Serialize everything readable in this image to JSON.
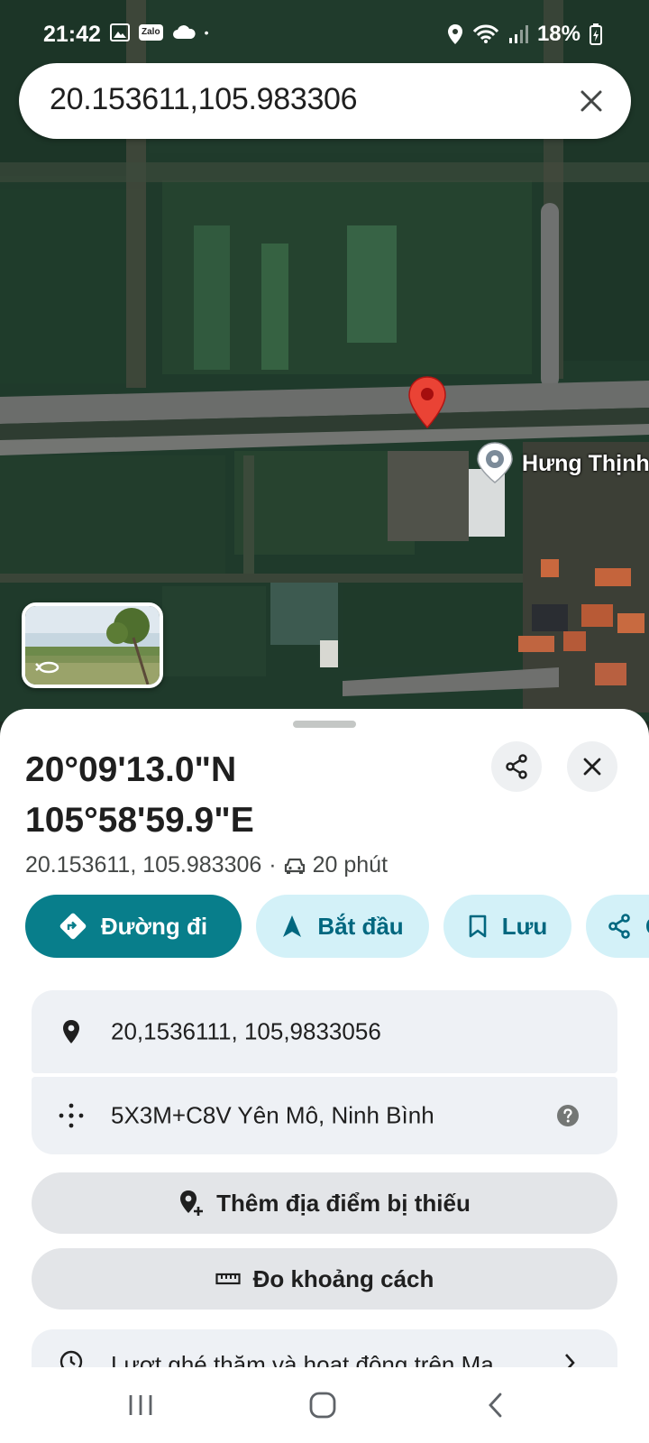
{
  "status_bar": {
    "time": "21:42",
    "zalo_label": "Zalo",
    "dot": "•",
    "battery": "18%"
  },
  "search": {
    "query": "20.153611,105.983306",
    "clear_icon": "close-icon"
  },
  "map": {
    "place_label": "Hưng Thịnh",
    "pin_color": "#ea4335"
  },
  "sheet": {
    "title_lat": "20°09'13.0\"N",
    "title_lng": "105°58'59.9\"E",
    "decimal_coords": "20.153611, 105.983306",
    "separator": "·",
    "drive_time": "20 phút",
    "actions": [
      {
        "label": "Đường đi",
        "icon": "directions-icon"
      },
      {
        "label": "Bắt đầu",
        "icon": "navigation-arrow-icon"
      },
      {
        "label": "Lưu",
        "icon": "bookmark-icon"
      },
      {
        "label": "Ch",
        "icon": "share-icon"
      }
    ],
    "coords_row": "20,1536111, 105,9833056",
    "pluscode_row": "5X3M+C8V Yên Mô, Ninh Bình",
    "add_missing_place": "Thêm địa điểm bị thiếu",
    "measure_distance": "Đo khoảng cách",
    "partial_row": "Lượt ghé thăm và hoạt động trên Ma"
  },
  "colors": {
    "accent": "#087e8b",
    "chip_bg": "#d3f1f8",
    "chip_text": "#00677f"
  }
}
